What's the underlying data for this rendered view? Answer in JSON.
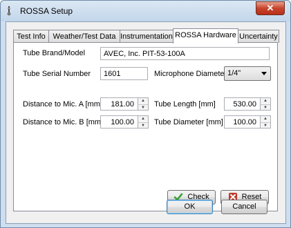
{
  "window": {
    "title": "ROSSA Setup",
    "close_glyph": "✕"
  },
  "tabs": [
    {
      "label": "Test Info"
    },
    {
      "label": "Weather/Test Data"
    },
    {
      "label": "Instrumentation"
    },
    {
      "label": "ROSSA Hardware",
      "active": true
    },
    {
      "label": "Uncertainty"
    }
  ],
  "form": {
    "tube_brand_model": {
      "label": "Tube Brand/Model",
      "value": "AVEC, Inc. PIT-53-100A"
    },
    "tube_serial_number": {
      "label": "Tube Serial Number",
      "value": "1601"
    },
    "microphone_diameter": {
      "label": "Microphone Diameter",
      "value": "1/4\""
    },
    "distance_mic_a": {
      "label": "Distance to Mic. A [mm]",
      "value": "181.00"
    },
    "distance_mic_b": {
      "label": "Distance to Mic. B [mm]",
      "value": "100.00"
    },
    "tube_length": {
      "label": "Tube Length [mm]",
      "value": "530.00"
    },
    "tube_diameter": {
      "label": "Tube Diameter [mm]",
      "value": "100.00"
    }
  },
  "buttons": {
    "check": "Check",
    "reset": "Reset",
    "ok": "OK",
    "cancel": "Cancel"
  },
  "icons": {
    "app": "app-icon",
    "check": "checkmark-icon",
    "reset": "reset-icon"
  },
  "colors": {
    "check_green": "#3aa335",
    "reset_red": "#c0392b"
  }
}
